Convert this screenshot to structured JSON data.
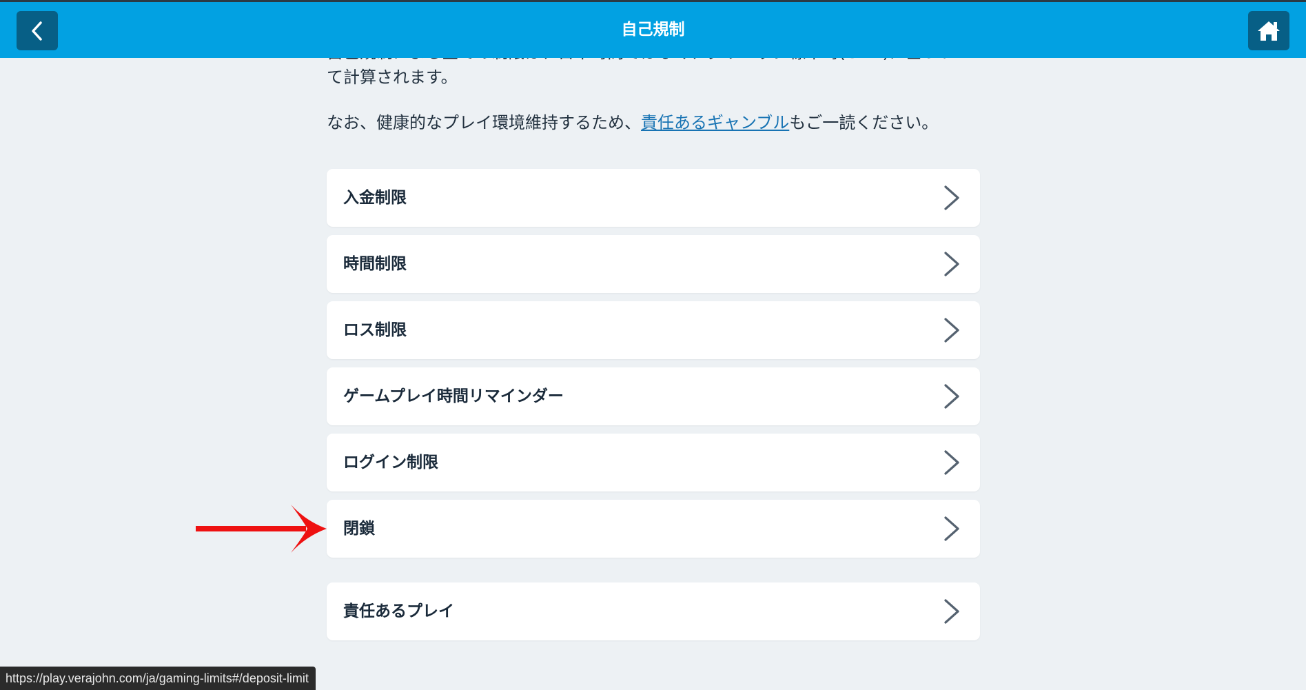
{
  "header": {
    "title": "自己規制",
    "back_icon": "chevron-left-icon",
    "home_icon": "home-icon"
  },
  "intro": {
    "line1_partial": "自己規制による全ての制限は、日本時間ではなく、グリニッジ標準時(GMT)に基づい",
    "line2": "て計算されます。",
    "note_before": "なお、健康的なプレイ環境維持するため、",
    "note_link": "責任あるギャンブル",
    "note_after": "もご一読ください。"
  },
  "menu": {
    "items": [
      {
        "label": "入金制限"
      },
      {
        "label": "時間制限"
      },
      {
        "label": "ロス制限"
      },
      {
        "label": "ゲームプレイ時間リマインダー"
      },
      {
        "label": "ログイン制限"
      },
      {
        "label": "閉鎖"
      }
    ],
    "extra": {
      "label": "責任あるプレイ"
    }
  },
  "annotation": {
    "arrow_color": "#ee1111"
  },
  "statusbar": {
    "url": "https://play.verajohn.com/ja/gaming-limits#/deposit-limit"
  },
  "colors": {
    "header_bg": "#02a1e2",
    "header_btn_bg": "#075f86",
    "page_bg": "#edf1f4",
    "link": "#1773b3"
  }
}
